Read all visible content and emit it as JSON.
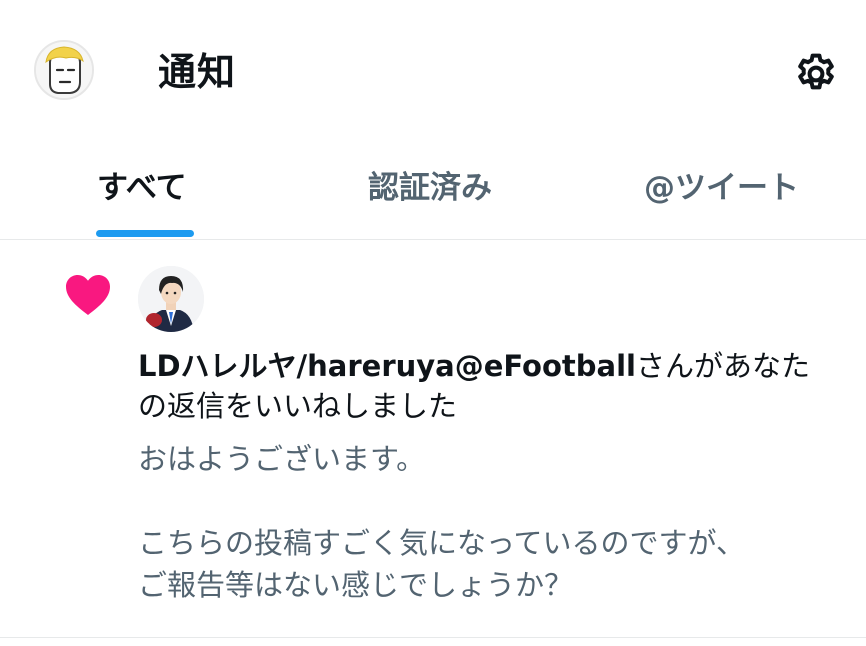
{
  "header": {
    "title": "通知",
    "avatar_icon": "user-avatar-yellow-hair",
    "settings_icon": "gear-icon"
  },
  "tabs": [
    {
      "label": "すべて",
      "active": true
    },
    {
      "label": "認証済み",
      "active": false
    },
    {
      "label": "@ツイート",
      "active": false
    }
  ],
  "notification": {
    "type_icon": "heart-icon",
    "user": "LDハレルヤ/hareruya@eFootball",
    "action": "さんがあなたの返信をいいねしました",
    "reply_line1": "おはようございます。",
    "reply_line2": "こちらの投稿すごく気になっているのですが、",
    "reply_line3": "ご報告等はない感じでしょうか？"
  },
  "colors": {
    "accent": "#1d9bf0",
    "heart": "#f91880",
    "text_primary": "#0f1419",
    "text_secondary": "#536471",
    "divider": "#e7e9ea"
  }
}
